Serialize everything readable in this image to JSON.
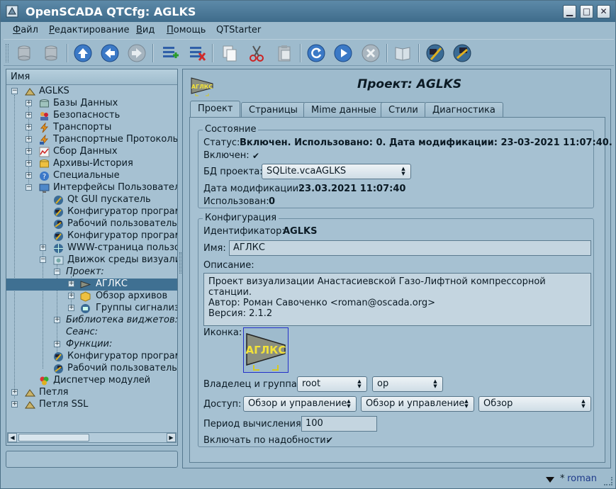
{
  "window": {
    "title": "OpenSCADA QTCfg: AGLKS"
  },
  "menu": [
    "Файл",
    "Редактирование",
    "Вид",
    "Помощь",
    "QTStarter"
  ],
  "toolbar": {
    "buttons": [
      "database-load-icon",
      "database-save-icon",
      "up-icon",
      "back-icon",
      "forward-icon",
      "add-item-icon",
      "delete-item-icon",
      "copy-icon",
      "cut-icon",
      "paste-icon",
      "refresh-icon",
      "start-icon",
      "stop-icon",
      "manual-icon",
      "module-qtcfg-icon",
      "module-vision-icon"
    ]
  },
  "tree": {
    "header": "Имя",
    "items": [
      {
        "label": "AGLKS"
      },
      {
        "label": "Базы Данных"
      },
      {
        "label": "Безопасность"
      },
      {
        "label": "Транспорты"
      },
      {
        "label": "Транспортные Протоколы"
      },
      {
        "label": "Сбор Данных"
      },
      {
        "label": "Архивы-История"
      },
      {
        "label": "Специальные"
      },
      {
        "label": "Интерфейсы Пользователя"
      },
      {
        "label": "Qt GUI пускатель"
      },
      {
        "label": "Конфигуратор программ"
      },
      {
        "label": "Рабочий пользовательск"
      },
      {
        "label": "Конфигуратор программ"
      },
      {
        "label": "WWW-страница пользов"
      },
      {
        "label": "Движок среды визуализ"
      },
      {
        "label": "Проект:"
      },
      {
        "label": "АГЛКС"
      },
      {
        "label": "Обзор архивов"
      },
      {
        "label": "Группы сигнализа"
      },
      {
        "label": "Библиотека виджетов:"
      },
      {
        "label": "Сеанс:"
      },
      {
        "label": "Функции:"
      },
      {
        "label": "Конфигуратор программ"
      },
      {
        "label": "Рабочий пользовательск"
      },
      {
        "label": "Диспетчер модулей"
      },
      {
        "label": "Петля"
      },
      {
        "label": "Петля SSL"
      }
    ]
  },
  "page": {
    "title": "Проект: AGLKS",
    "icon_text": "АГЛКС",
    "tabs": [
      "Проект",
      "Страницы",
      "Mime данные",
      "Стили",
      "Диагностика"
    ],
    "state": {
      "group_title": "Состояние",
      "status_label": "Статус:",
      "status_value": "Включен. Использовано: 0. Дата модификации: 23-03-2021 11:07:40.",
      "enabled_label": "Включен:",
      "enabled": true,
      "db_label": "БД проекта:",
      "db_value": "SQLite.vcaAGLKS",
      "modif_label": "Дата модификации:",
      "modif_value": "23.03.2021 11:07:40",
      "used_label": "Использован:",
      "used_value": "0"
    },
    "config": {
      "group_title": "Конфигурация",
      "id_label": "Идентификатор:",
      "id_value": "AGLKS",
      "name_label": "Имя:",
      "name_value": "АГЛКС",
      "descr_label": "Описание:",
      "descr_lines": [
        "Проект визуализации Анастасиевской Газо-Лифтной компрессорной станции.",
        "Автор: Роман Савоченко <roman@oscada.org>",
        "Версия: 2.1.2"
      ],
      "icon_label": "Иконка:",
      "owner_label": "Владелец и группа:",
      "owner_value": "root",
      "group_value": "op",
      "access_label": "Доступ:",
      "access_owner": "Обзор и управление",
      "access_group": "Обзор и управление",
      "access_other": "Обзор",
      "period_label": "Период вычисления:",
      "period_value": "100",
      "ondemand_label": "Включать по надобности:",
      "ondemand": true
    }
  },
  "statusbar": {
    "user": "roman",
    "star": "*"
  }
}
